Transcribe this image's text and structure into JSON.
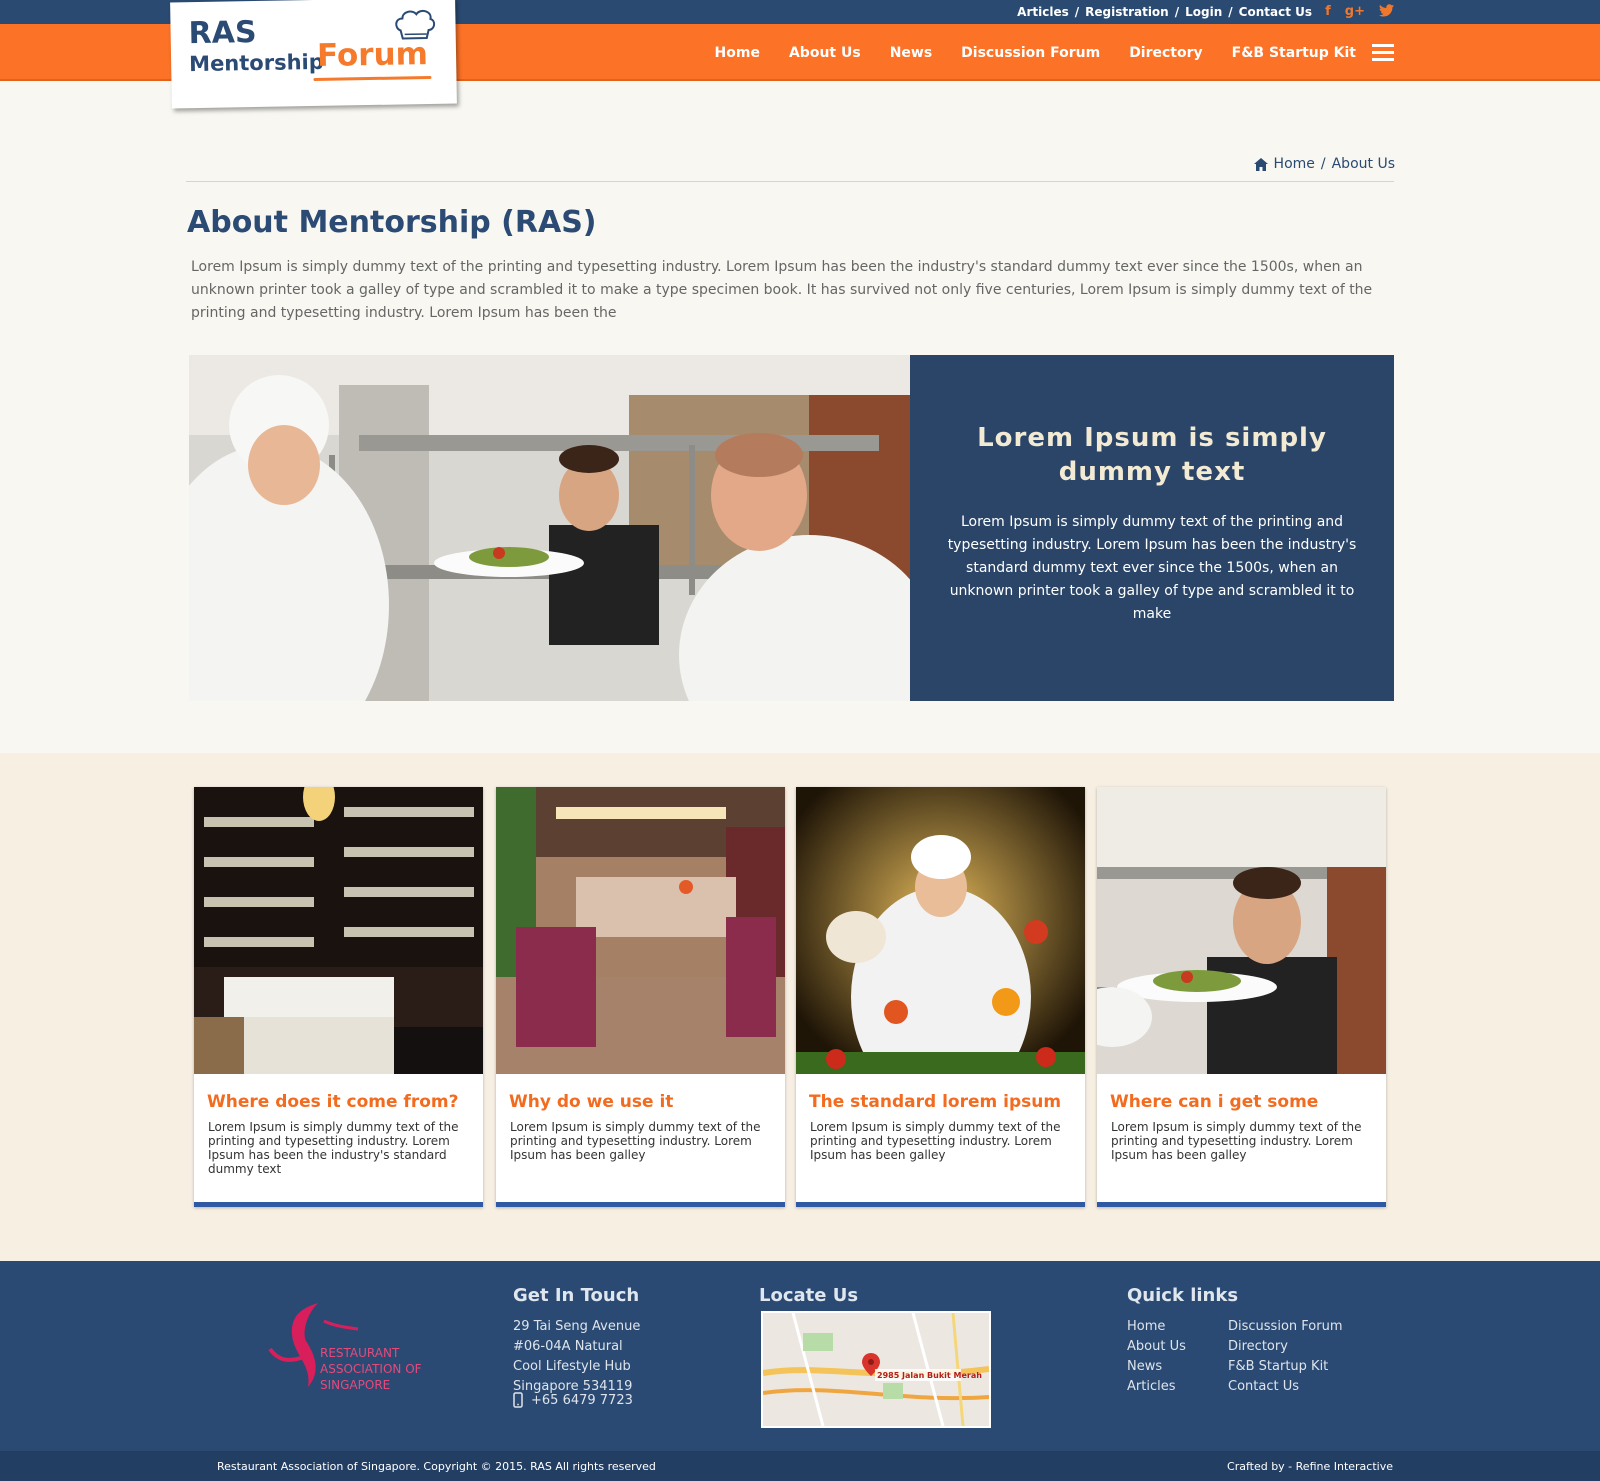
{
  "topbar": {
    "links": [
      "Articles",
      "Registration",
      "Login",
      "Contact Us"
    ],
    "social": [
      "facebook-icon",
      "google-plus-icon",
      "twitter-icon"
    ]
  },
  "logo": {
    "line1": "RAS",
    "line2": "Mentorship",
    "line3": "Forum"
  },
  "nav": {
    "items": [
      "Home",
      "About Us",
      "News",
      "Discussion Forum",
      "Directory",
      "F&B Startup Kit"
    ]
  },
  "breadcrumb": {
    "home": "Home",
    "current": "About Us"
  },
  "page": {
    "title": "About Mentorship (RAS)",
    "intro": "Lorem Ipsum is simply dummy text of the printing and typesetting industry. Lorem Ipsum has been the industry's standard dummy text ever since the 1500s, when an unknown printer took a galley of type and scrambled it to make a type specimen book. It has survived not only five centuries, Lorem Ipsum is simply dummy text of the printing and typesetting industry. Lorem Ipsum has been the"
  },
  "hero": {
    "heading": "Lorem Ipsum is simply dummy text",
    "body": "Lorem Ipsum is simply dummy text of the printing and typesetting industry. Lorem Ipsum has been the industry's standard dummy text ever since the 1500s, when an unknown printer took a galley of type and scrambled it to make"
  },
  "cards": [
    {
      "title": "Where does it come from?",
      "body": "Lorem Ipsum is simply dummy text of the printing and typesetting industry. Lorem Ipsum has been the industry's standard dummy text"
    },
    {
      "title": "Why do we use it",
      "body": "Lorem Ipsum is simply dummy text of the printing and typesetting industry. Lorem Ipsum has been galley"
    },
    {
      "title": "The standard lorem ipsum",
      "body": "Lorem Ipsum is simply dummy text of the printing and typesetting industry. Lorem Ipsum has been galley"
    },
    {
      "title": "Where can i get some",
      "body": "Lorem Ipsum is simply dummy text of the printing and typesetting industry. Lorem Ipsum has been galley"
    }
  ],
  "footer": {
    "logo_text": [
      "RESTAURANT",
      "ASSOCIATION OF",
      "SINGAPORE"
    ],
    "contact": {
      "heading": "Get In Touch",
      "address": [
        "29 Tai Seng Avenue",
        "#06-04A Natural",
        "Cool Lifestyle Hub",
        "Singapore 534119"
      ],
      "phone": "+65 6479 7723"
    },
    "locate": {
      "heading": "Locate Us",
      "map_label": "2985 Jalan Bukit Merah"
    },
    "quicklinks": {
      "heading": "Quick links",
      "col1": [
        "Home",
        "About Us",
        "News",
        "Articles"
      ],
      "col2": [
        "Discussion Forum",
        "Directory",
        "F&B Startup Kit",
        "Contact Us"
      ]
    },
    "copyright": "Restaurant Association of Singapore. Copyright © 2015. RAS All rights reserved",
    "credit": "Crafted by - Refine Interactive"
  },
  "colors": {
    "navy": "#2a4a72",
    "orange": "#fc7227",
    "card_accent": "#2f5aa3"
  }
}
